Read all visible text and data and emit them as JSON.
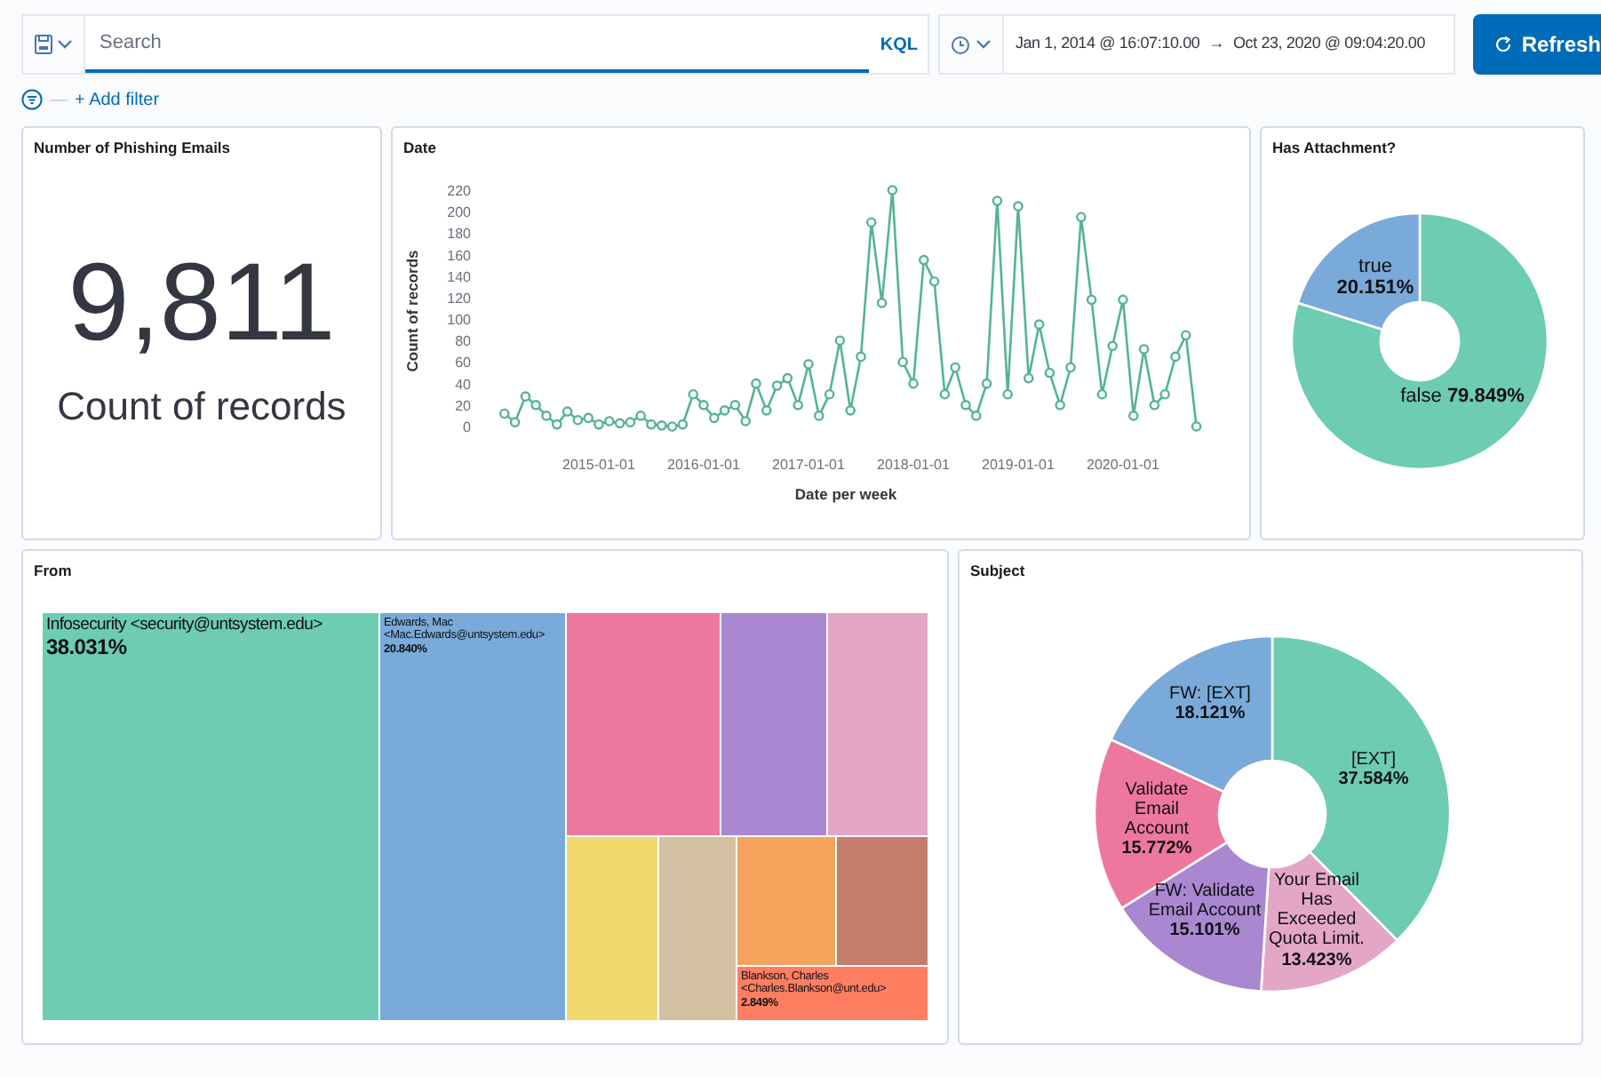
{
  "query_bar": {
    "search": {
      "placeholder": "Search"
    },
    "language_button": "KQL",
    "date_range": {
      "start": "Jan 1, 2014 @ 16:07:10.00",
      "arrow": "→",
      "end": "Oct 23, 2020 @ 09:04:20.00"
    },
    "refresh_button": "Refresh"
  },
  "filter_bar": {
    "separator": "—",
    "add_filter": "+ Add filter"
  },
  "panels": {
    "metric": {
      "title": "Number of Phishing Emails",
      "value": "9,811",
      "label": "Count of records"
    },
    "date": {
      "title": "Date",
      "chart_data": {
        "type": "line",
        "xlabel": "Date per week",
        "ylabel": "Count of records",
        "categories": [
          null,
          null,
          null,
          null,
          null,
          null,
          null,
          null,
          null,
          "2015-01-01",
          null,
          null,
          null,
          null,
          null,
          null,
          null,
          null,
          null,
          "2016-01-01",
          null,
          null,
          null,
          null,
          null,
          null,
          null,
          null,
          null,
          "2017-01-01",
          null,
          null,
          null,
          null,
          null,
          null,
          null,
          null,
          null,
          "2018-01-01",
          null,
          null,
          null,
          null,
          null,
          null,
          null,
          null,
          null,
          "2019-01-01",
          null,
          null,
          null,
          null,
          null,
          null,
          null,
          null,
          null,
          "2020-01-01",
          null,
          null,
          null,
          null,
          null,
          null,
          null
        ],
        "series": [
          {
            "color": "#54b399",
            "marker": true,
            "values": [
              12,
              4,
              28,
              20,
              10,
              2,
              14,
              6,
              8,
              2,
              5,
              3,
              4,
              10,
              2,
              1,
              0,
              2,
              30,
              20,
              8,
              15,
              20,
              5,
              40,
              15,
              38,
              45,
              20,
              58,
              10,
              30,
              80,
              15,
              65,
              190,
              115,
              220,
              60,
              40,
              155,
              135,
              30,
              55,
              20,
              10,
              40,
              210,
              30,
              205,
              45,
              95,
              50,
              20,
              55,
              195,
              118,
              30,
              75,
              118,
              10,
              72,
              20,
              30,
              65,
              85,
              0
            ]
          }
        ],
        "ylim": [
          0,
          220
        ],
        "yticks": [
          0,
          20,
          40,
          60,
          80,
          100,
          120,
          140,
          160,
          180,
          200,
          220
        ]
      }
    },
    "attachment": {
      "title": "Has Attachment?",
      "chart_data": {
        "type": "donut",
        "categories": [
          "false",
          "true"
        ],
        "values": [
          79.849,
          20.151
        ],
        "colors": [
          "#6dccb1",
          "#79aad9"
        ],
        "value_labels": [
          "79.849%",
          "20.151%"
        ]
      }
    },
    "from": {
      "title": "From",
      "tiles": [
        {
          "name": "Infosecurity <security@untsystem.edu>",
          "percent": "38.031%",
          "color": "#6dccb1"
        },
        {
          "name": "Edwards, Mac <Mac.Edwards@untsystem.edu>",
          "percent": "20.840%",
          "color": "#79aad9"
        },
        {
          "color": "#ee789d"
        },
        {
          "color": "#a987d1"
        },
        {
          "color": "#e4a6c7"
        },
        {
          "color": "#f1d86f"
        },
        {
          "color": "#d2c0a0"
        },
        {
          "color": "#f5a35c"
        },
        {
          "color": "#c47c6c"
        },
        {
          "name": "Blankson, Charles <Charles.Blankson@unt.edu>",
          "percent": "2.849%",
          "color": "#ff7e62"
        }
      ]
    },
    "subject": {
      "title": "Subject",
      "chart_data": {
        "type": "donut",
        "categories": [
          "[EXT]",
          "Your Email Has Exceeded Quota Limit.",
          "FW: Validate Email Account",
          "Validate Email Account",
          "FW: [EXT]"
        ],
        "values": [
          37.584,
          13.423,
          15.101,
          15.772,
          18.121
        ],
        "colors": [
          "#6dccb1",
          "#e4a6c7",
          "#a987d1",
          "#ee789d",
          "#79aad9"
        ],
        "value_labels": [
          "37.584%",
          "13.423%",
          "15.101%",
          "15.772%",
          "18.121%"
        ]
      }
    }
  }
}
